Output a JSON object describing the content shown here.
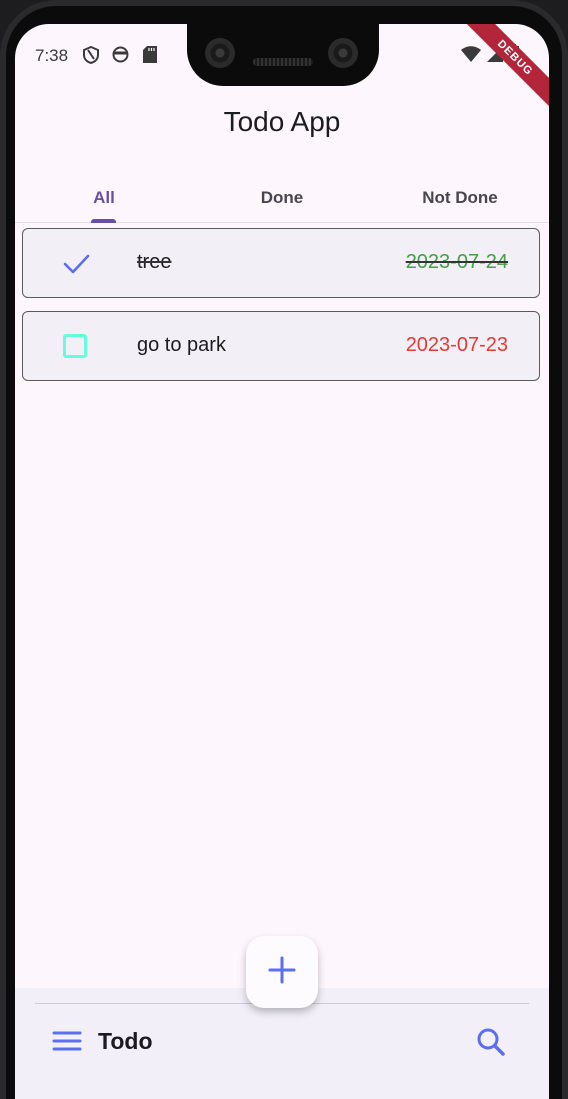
{
  "status_bar": {
    "time": "7:38",
    "left_icons": [
      "shield-icon",
      "face-icon",
      "sd-card-icon"
    ],
    "right_icons": [
      "wifi-icon",
      "signal-icon",
      "battery-icon"
    ]
  },
  "debug_banner": "DEBUG",
  "app_bar": {
    "title": "Todo App"
  },
  "tabs": [
    {
      "label": "All",
      "active": true
    },
    {
      "label": "Done",
      "active": false
    },
    {
      "label": "Not Done",
      "active": false
    }
  ],
  "todos": [
    {
      "title": "tree",
      "date": "2023-07-24",
      "done": true
    },
    {
      "title": "go to park",
      "date": "2023-07-23",
      "done": false
    }
  ],
  "fab": {
    "icon": "add-icon"
  },
  "bottom_bar": {
    "title": "Todo",
    "menu_icon": "menu-icon",
    "search_icon": "search-icon"
  },
  "colors": {
    "accent": "#6750a4",
    "icon_blue": "#5b6ef0",
    "done_date": "#43a047",
    "pending_date": "#e53935",
    "checkbox_border": "#64ffda"
  }
}
